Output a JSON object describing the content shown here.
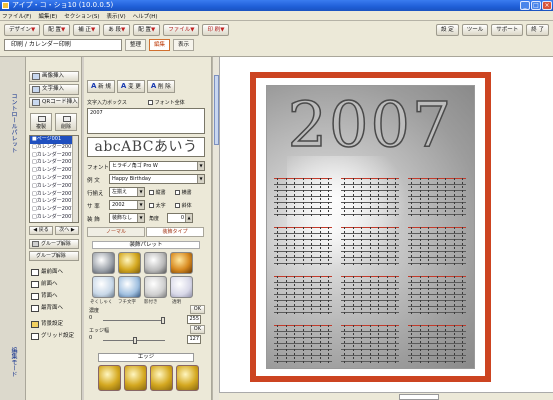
{
  "window": {
    "title": "アイプ・コ・ショ10 (10.0.0.5)",
    "buttons": [
      "_",
      "□",
      "×"
    ]
  },
  "menubar": [
    "ファイル(F)",
    "編集(E)",
    "セクション(S)",
    "表示(V)",
    "ヘルプ(H)"
  ],
  "toolbar": {
    "row1": [
      {
        "label": "デザイン",
        "caret": "▼"
      },
      {
        "label": "配 置",
        "caret": "▼"
      },
      {
        "label": "補 正",
        "caret": "▼"
      },
      {
        "label": "あ 段",
        "caret": "▼"
      },
      {
        "label": "配 置",
        "caret": "▼"
      },
      {
        "label": "ファイル",
        "caret": "▼"
      },
      {
        "label": "印 刷",
        "caret": "▼"
      }
    ],
    "right_buttons": [
      "設 定",
      "ツール",
      "サポート",
      "終 了"
    ],
    "breadcrumb": "印刷 / カレンダー印刷",
    "tabs": [
      {
        "label": "整理",
        "active": false
      },
      {
        "label": "編集",
        "active": true
      },
      {
        "label": "表示",
        "active": false
      }
    ]
  },
  "strip_labels": [
    "コントロールパレット",
    "編集モード"
  ],
  "leftpanel": {
    "insert_buttons": [
      "画像挿入",
      "文字挿入",
      "QRコード挿入"
    ],
    "square_buttons": [
      "複製",
      "削除"
    ],
    "list_items": [
      "■ページ001",
      "□カレンダー2007",
      "□カレンダー2007",
      "□カレンダー2007",
      "□カレンダー2007",
      "□カレンダー2007",
      "□カレンダー2007",
      "□カレンダー2007",
      "□カレンダー2007",
      "□カレンダー2007",
      "□カレンダー2007"
    ],
    "nav_prev": "◀ 戻る",
    "nav_next": "次へ ▶",
    "group_buttons": [
      "グループ解除",
      "グループ解除"
    ],
    "order_buttons": [
      "最前面へ",
      "前面へ",
      "背面へ",
      "最背面へ"
    ],
    "bg_buttons": [
      "背景設定",
      "グリッド設定"
    ]
  },
  "textpanel": {
    "tabs": [
      {
        "glyph": "A",
        "label": "新 規"
      },
      {
        "glyph": "A",
        "label": "変 更"
      },
      {
        "glyph": "A",
        "label": "削 除"
      }
    ],
    "textbox_label": "文字入力ボックス",
    "fontsize_check": "フォント全体",
    "textarea_value": "2007",
    "preview_text": "abcABCあいう",
    "font_label": "フォント",
    "font_value": "ヒラギノ角ゴ Pro W",
    "sentence_label": "例 文",
    "sentence_value": "Happy Birthday",
    "align_label": "行揃え",
    "align_value": "左揃え",
    "vertical_label": "縦書",
    "horizontal_label": "横書",
    "size_label": "サ 率",
    "size_value": "2002",
    "bold_label": "太字",
    "italic_label": "斜体",
    "color_label": "装 飾",
    "color_value": "装飾なし",
    "angle_label": "角度",
    "angle_value": "0",
    "subtabs": [
      {
        "label": "ノーマル",
        "active": false
      },
      {
        "label": "装飾タイプ",
        "active": true
      }
    ],
    "palette_title": "装飾パレット",
    "swatch_labels": [
      "ぞくしゃく",
      "フチ文字",
      "影付き",
      "透明"
    ],
    "depth_label": "濃度",
    "depth_min": "0",
    "depth_value": "255",
    "edge_label": "エッジ幅",
    "edge_min": "0",
    "edge_value": "127",
    "apply_label": "OK",
    "edge_title": "エッジ"
  },
  "calendar": {
    "year": "2007"
  },
  "colors": {
    "frame": "#cc4421",
    "accent": "#1f5fd8"
  }
}
